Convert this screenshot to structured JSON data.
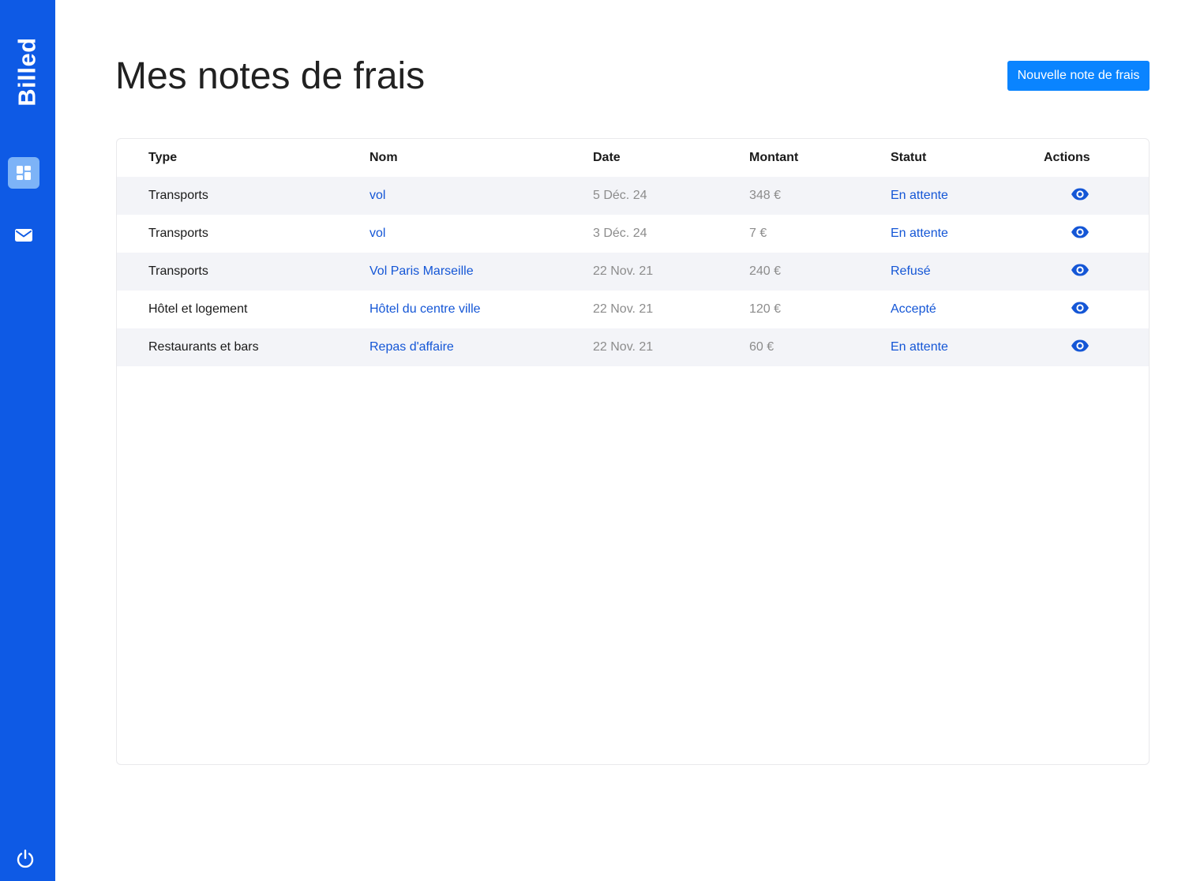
{
  "app": {
    "logo_text": "Billed"
  },
  "sidebar": {
    "items": [
      {
        "name": "dashboard",
        "icon": "grid-icon",
        "active": true
      },
      {
        "name": "mail",
        "icon": "mail-icon",
        "active": false
      }
    ],
    "logout_icon": "power-icon"
  },
  "header": {
    "title": "Mes notes de frais",
    "new_bill_label": "Nouvelle note de frais"
  },
  "table": {
    "columns": [
      "Type",
      "Nom",
      "Date",
      "Montant",
      "Statut",
      "Actions"
    ],
    "rows": [
      {
        "type": "Transports",
        "name": "vol",
        "date": "5 Déc. 24",
        "amount": "348 €",
        "status": "En attente",
        "action_icon": "eye-icon"
      },
      {
        "type": "Transports",
        "name": "vol",
        "date": "3 Déc. 24",
        "amount": "7 €",
        "status": "En attente",
        "action_icon": "eye-icon"
      },
      {
        "type": "Transports",
        "name": "Vol Paris Marseille",
        "date": "22 Nov. 21",
        "amount": "240 €",
        "status": "Refusé",
        "action_icon": "eye-icon"
      },
      {
        "type": "Hôtel et logement",
        "name": "Hôtel du centre ville",
        "date": "22 Nov. 21",
        "amount": "120 €",
        "status": "Accepté",
        "action_icon": "eye-icon"
      },
      {
        "type": "Restaurants et bars",
        "name": "Repas d'affaire",
        "date": "22 Nov. 21",
        "amount": "60 €",
        "status": "En attente",
        "action_icon": "eye-icon"
      }
    ]
  },
  "colors": {
    "sidebar": "#0e5ae5",
    "active_nav": "#7db3f7",
    "primary_button": "#0a84ff",
    "link": "#1456d6",
    "muted": "#8c8c8c",
    "stripe": "#f3f4f8"
  }
}
